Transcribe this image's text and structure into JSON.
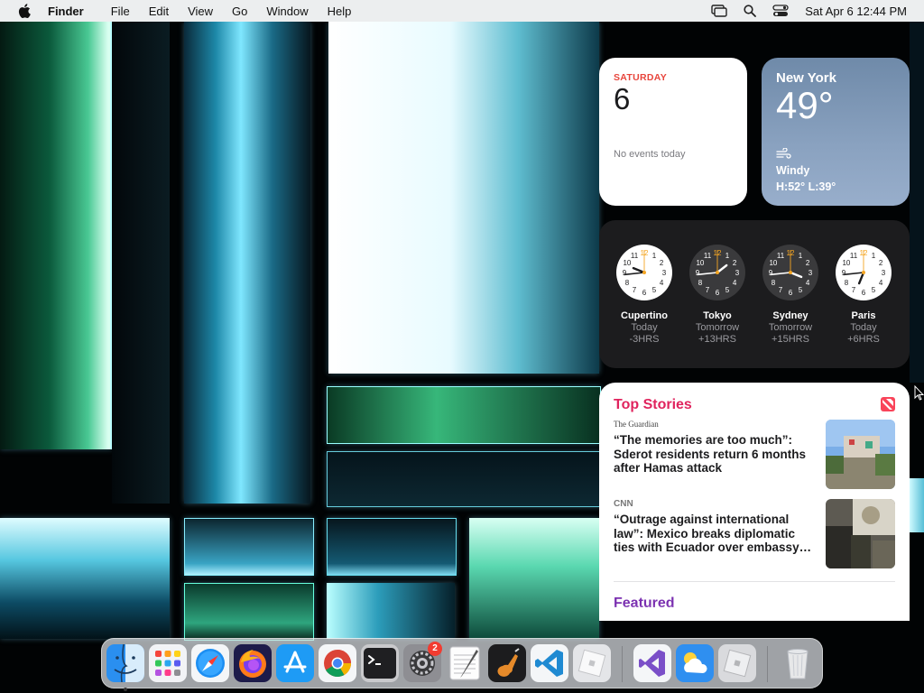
{
  "menubar": {
    "app_name": "Finder",
    "items": [
      "File",
      "Edit",
      "View",
      "Go",
      "Window",
      "Help"
    ],
    "status_icons": [
      "screen-mirroring-icon",
      "spotlight-search-icon",
      "control-center-icon"
    ],
    "datetime": "Sat Apr 6  12:44 PM"
  },
  "calendar_widget": {
    "weekday": "SATURDAY",
    "date": "6",
    "events_text": "No events today",
    "accent": "#e8453c"
  },
  "weather_widget": {
    "city": "New York",
    "temperature": "49°",
    "condition": "Windy",
    "high_low": "H:52° L:39°",
    "icon": "wind-icon"
  },
  "world_clock_widget": {
    "clocks": [
      {
        "city": "Cupertino",
        "day": "Today",
        "offset": "-3HRS",
        "hour": 9,
        "minute": 44,
        "face": "light"
      },
      {
        "city": "Tokyo",
        "day": "Tomorrow",
        "offset": "+13HRS",
        "hour": 1,
        "minute": 44,
        "face": "dark"
      },
      {
        "city": "Sydney",
        "day": "Tomorrow",
        "offset": "+15HRS",
        "hour": 3,
        "minute": 44,
        "face": "dark"
      },
      {
        "city": "Paris",
        "day": "Today",
        "offset": "+6HRS",
        "hour": 6,
        "minute": 44,
        "face": "light"
      }
    ]
  },
  "news_widget": {
    "heading": "Top Stories",
    "stories": [
      {
        "source": "The Guardian",
        "title": "“The memories are too much”: Sderot residents return 6 months after Hamas attack"
      },
      {
        "source": "CNN",
        "title": "“Outrage against international law”: Mexico breaks diplomatic ties with Ecuador over embassy…"
      }
    ],
    "featured_heading": "Featured",
    "heading_color": "#e0245e",
    "featured_color": "#7a2fb0"
  },
  "dock": {
    "apps": [
      {
        "name": "Finder",
        "icon": "finder-icon",
        "running": true
      },
      {
        "name": "Launchpad",
        "icon": "launchpad-icon"
      },
      {
        "name": "Safari",
        "icon": "safari-icon"
      },
      {
        "name": "Firefox",
        "icon": "firefox-icon"
      },
      {
        "name": "App Store",
        "icon": "app-store-icon"
      },
      {
        "name": "Google Chrome",
        "icon": "chrome-icon"
      },
      {
        "name": "Terminal",
        "icon": "terminal-icon"
      },
      {
        "name": "System Settings",
        "icon": "system-settings-icon",
        "badge": "2"
      },
      {
        "name": "TextEdit",
        "icon": "textedit-icon"
      },
      {
        "name": "GarageBand",
        "icon": "garageband-icon"
      },
      {
        "name": "Visual Studio Code",
        "icon": "vscode-icon"
      },
      {
        "name": "Roblox",
        "icon": "roblox-icon"
      },
      {
        "name": "Visual Studio",
        "icon": "visual-studio-icon"
      },
      {
        "name": "Weather",
        "icon": "weather-icon"
      },
      {
        "name": "Roblox Studio",
        "icon": "roblox-studio-icon"
      },
      {
        "name": "Trash",
        "icon": "trash-icon"
      }
    ]
  }
}
